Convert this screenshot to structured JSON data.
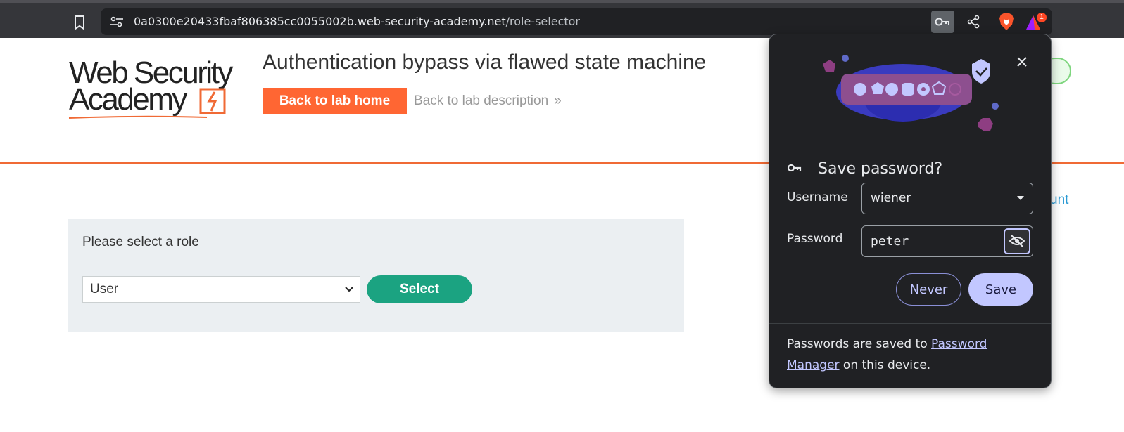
{
  "browser": {
    "url_host": "0a0300e20433fbaf806385cc0055002b.web-security-academy.net",
    "url_path": "/role-selector",
    "extension_badge": "1"
  },
  "header": {
    "logo_line1": "Web Security",
    "logo_line2": "Academy",
    "lab_title": "Authentication bypass via flawed state machine",
    "back_home_label": "Back to lab home",
    "back_description_label": "Back to lab description",
    "back_description_chevron": "»"
  },
  "account_link_fragment": "unt",
  "role_form": {
    "prompt": "Please select a role",
    "selected_role": "User",
    "select_button_label": "Select"
  },
  "password_popup": {
    "title": "Save password?",
    "username_label": "Username",
    "username_value": "wiener",
    "password_label": "Password",
    "password_value": "peter",
    "never_label": "Never",
    "save_label": "Save",
    "footer_prefix": "Passwords are saved to ",
    "footer_link": "Password Manager",
    "footer_suffix": " on this device."
  },
  "colors": {
    "brand_orange": "#ff6633",
    "select_green": "#1ba381",
    "popup_bg": "#202124",
    "popup_accent": "#c2c7ff"
  }
}
